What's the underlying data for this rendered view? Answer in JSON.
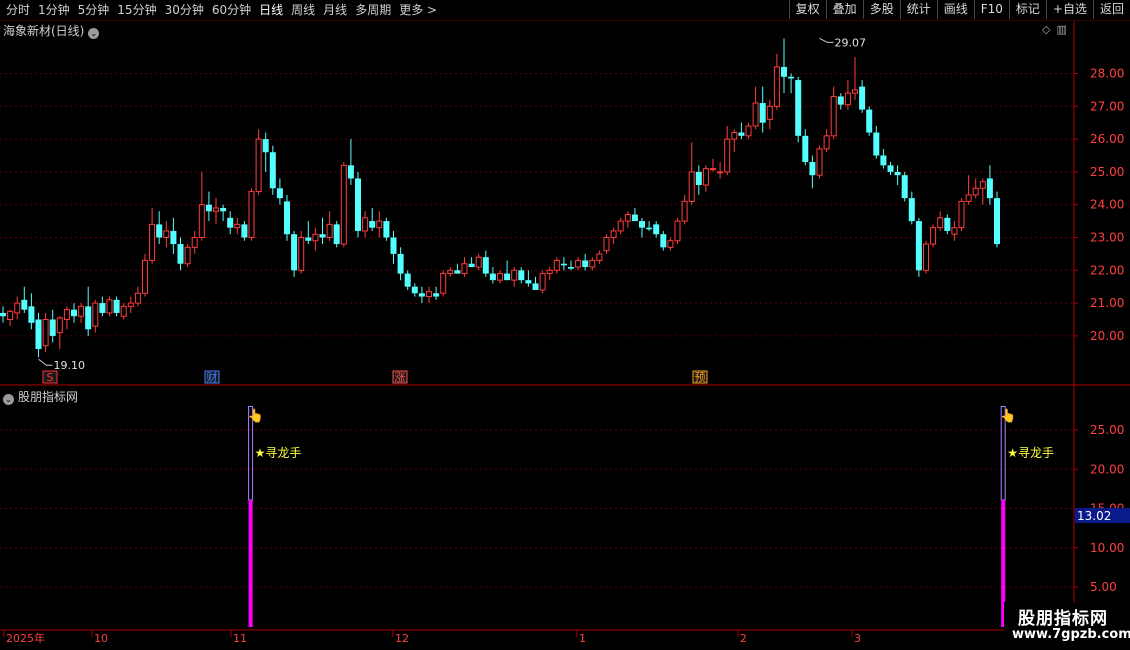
{
  "toolbar": {
    "periods": [
      "分时",
      "1分钟",
      "5分钟",
      "15分钟",
      "30分钟",
      "60分钟",
      "日线",
      "周线",
      "月线",
      "多周期",
      "更多 >"
    ],
    "active_period": "日线",
    "tools": [
      "复权",
      "叠加",
      "多股",
      "统计",
      "画线",
      "F10",
      "标记",
      "+自选",
      "返回"
    ]
  },
  "chart": {
    "title": "海象新材(日线)",
    "high_label": "29.07",
    "low_label": "19.10",
    "y_ticks": [
      "28.00",
      "27.00",
      "26.00",
      "25.00",
      "24.00",
      "23.00",
      "22.00",
      "21.00",
      "20.00"
    ],
    "markers": [
      {
        "label": "S",
        "color": "#ff3030"
      },
      {
        "label": "财",
        "color": "#4080ff"
      },
      {
        "label": "涨",
        "color": "#ff5050"
      },
      {
        "label": "预",
        "color": "#ffa020"
      }
    ]
  },
  "indicator": {
    "title": "股朋指标网",
    "y_ticks": [
      "25.00",
      "20.00",
      "15.00",
      "10.00",
      "5.00"
    ],
    "current_value": "13.02",
    "signal_label": "★寻龙手"
  },
  "time_axis": [
    "2025年",
    "10",
    "11",
    "12",
    "1",
    "2",
    "3"
  ],
  "watermark": {
    "line1": "股朋指标网",
    "line2": "www.7gpzb.com"
  },
  "colors": {
    "up": "#ff3c3c",
    "down": "#54ffff",
    "signal": "#ff00ff",
    "grid": "#5a0000",
    "axis": "#b00000"
  },
  "chart_data": {
    "type": "candlestick",
    "title": "海象新材(日线)",
    "ylim": [
      19.2,
      29.6
    ],
    "candles": [
      [
        20.7,
        20.9,
        20.4,
        20.6
      ],
      [
        20.5,
        20.8,
        20.3,
        20.75
      ],
      [
        20.7,
        21.2,
        20.5,
        21.0
      ],
      [
        21.1,
        21.5,
        20.7,
        20.8
      ],
      [
        20.9,
        21.3,
        20.2,
        20.4
      ],
      [
        20.5,
        20.7,
        19.35,
        19.6
      ],
      [
        19.7,
        20.7,
        19.5,
        20.5
      ],
      [
        20.5,
        20.8,
        19.8,
        20.0
      ],
      [
        20.1,
        20.6,
        19.6,
        20.55
      ],
      [
        20.5,
        20.9,
        20.2,
        20.8
      ],
      [
        20.8,
        21.0,
        20.4,
        20.6
      ],
      [
        20.6,
        21.0,
        20.4,
        20.9
      ],
      [
        20.9,
        21.5,
        20.0,
        20.2
      ],
      [
        20.3,
        21.1,
        20.1,
        21.0
      ],
      [
        21.0,
        21.2,
        20.6,
        20.7
      ],
      [
        20.7,
        21.2,
        20.6,
        21.1
      ],
      [
        21.1,
        21.2,
        20.6,
        20.7
      ],
      [
        20.6,
        21.0,
        20.5,
        20.9
      ],
      [
        20.9,
        21.2,
        20.7,
        21.0
      ],
      [
        21.0,
        21.5,
        20.9,
        21.3
      ],
      [
        21.3,
        22.5,
        21.2,
        22.3
      ],
      [
        22.3,
        23.9,
        22.2,
        23.4
      ],
      [
        23.4,
        23.8,
        22.8,
        23.0
      ],
      [
        23.0,
        23.5,
        22.7,
        23.2
      ],
      [
        23.2,
        23.6,
        22.5,
        22.8
      ],
      [
        22.8,
        23.0,
        22.0,
        22.2
      ],
      [
        22.2,
        22.8,
        22.1,
        22.7
      ],
      [
        22.7,
        23.2,
        22.5,
        23.0
      ],
      [
        23.0,
        25.0,
        22.9,
        24.0
      ],
      [
        24.0,
        24.4,
        23.5,
        23.8
      ],
      [
        23.8,
        24.2,
        23.4,
        23.9
      ],
      [
        23.9,
        24.0,
        23.5,
        23.8
      ],
      [
        23.6,
        23.8,
        23.1,
        23.3
      ],
      [
        23.3,
        23.6,
        23.1,
        23.4
      ],
      [
        23.4,
        23.5,
        22.9,
        23.0
      ],
      [
        23.0,
        24.5,
        22.9,
        24.4
      ],
      [
        24.4,
        26.3,
        24.3,
        26.0
      ],
      [
        26.0,
        26.2,
        25.0,
        25.6
      ],
      [
        25.6,
        25.8,
        24.3,
        24.5
      ],
      [
        24.5,
        24.8,
        24.0,
        24.2
      ],
      [
        24.1,
        24.3,
        22.9,
        23.1
      ],
      [
        23.1,
        23.2,
        21.8,
        22.0
      ],
      [
        22.0,
        23.2,
        21.9,
        23.0
      ],
      [
        23.0,
        23.5,
        22.8,
        22.9
      ],
      [
        22.9,
        23.3,
        22.6,
        23.1
      ],
      [
        23.1,
        23.6,
        22.8,
        23.0
      ],
      [
        23.0,
        23.8,
        22.9,
        23.4
      ],
      [
        23.4,
        23.5,
        22.7,
        22.8
      ],
      [
        22.8,
        25.3,
        22.7,
        25.2
      ],
      [
        25.2,
        26.0,
        24.6,
        24.8
      ],
      [
        24.8,
        25.0,
        23.0,
        23.2
      ],
      [
        23.2,
        23.8,
        23.0,
        23.6
      ],
      [
        23.5,
        23.9,
        23.2,
        23.3
      ],
      [
        23.3,
        23.8,
        23.0,
        23.5
      ],
      [
        23.5,
        23.6,
        22.9,
        23.0
      ],
      [
        23.0,
        23.2,
        22.2,
        22.5
      ],
      [
        22.5,
        22.7,
        21.7,
        21.9
      ],
      [
        21.9,
        22.0,
        21.4,
        21.5
      ],
      [
        21.5,
        21.6,
        21.2,
        21.3
      ],
      [
        21.3,
        21.5,
        21.0,
        21.2
      ],
      [
        21.2,
        21.5,
        21.0,
        21.35
      ],
      [
        21.3,
        21.5,
        21.1,
        21.2
      ],
      [
        21.3,
        22.0,
        21.2,
        21.9
      ],
      [
        21.9,
        22.1,
        21.8,
        22.0
      ],
      [
        22.0,
        22.2,
        21.9,
        21.9
      ],
      [
        21.9,
        22.4,
        21.8,
        22.2
      ],
      [
        22.2,
        22.4,
        22.1,
        22.1
      ],
      [
        22.1,
        22.5,
        22.0,
        22.4
      ],
      [
        22.4,
        22.6,
        21.8,
        21.9
      ],
      [
        21.9,
        22.1,
        21.6,
        21.7
      ],
      [
        21.7,
        22.0,
        21.6,
        21.9
      ],
      [
        21.9,
        22.3,
        21.7,
        21.7
      ],
      [
        21.7,
        22.1,
        21.5,
        22.0
      ],
      [
        22.0,
        22.1,
        21.6,
        21.7
      ],
      [
        21.7,
        22.0,
        21.5,
        21.6
      ],
      [
        21.6,
        21.8,
        21.4,
        21.4
      ],
      [
        21.4,
        22.0,
        21.3,
        21.9
      ],
      [
        21.9,
        22.1,
        21.7,
        22.0
      ],
      [
        22.0,
        22.4,
        21.9,
        22.3
      ],
      [
        22.2,
        22.4,
        22.0,
        22.15
      ],
      [
        22.1,
        22.3,
        22.0,
        22.05
      ],
      [
        22.1,
        22.4,
        22.0,
        22.3
      ],
      [
        22.3,
        22.5,
        22.0,
        22.1
      ],
      [
        22.1,
        22.4,
        22.0,
        22.3
      ],
      [
        22.3,
        22.6,
        22.2,
        22.5
      ],
      [
        22.6,
        23.1,
        22.5,
        23.0
      ],
      [
        23.0,
        23.3,
        22.8,
        23.2
      ],
      [
        23.2,
        23.6,
        23.1,
        23.5
      ],
      [
        23.5,
        23.8,
        23.3,
        23.7
      ],
      [
        23.7,
        23.9,
        23.5,
        23.5
      ],
      [
        23.5,
        23.6,
        23.0,
        23.3
      ],
      [
        23.3,
        23.5,
        23.2,
        23.25
      ],
      [
        23.4,
        23.5,
        23.0,
        23.1
      ],
      [
        23.1,
        23.2,
        22.6,
        22.7
      ],
      [
        22.7,
        23.0,
        22.6,
        22.9
      ],
      [
        22.9,
        23.6,
        22.8,
        23.5
      ],
      [
        23.5,
        24.3,
        23.4,
        24.1
      ],
      [
        24.1,
        25.9,
        24.0,
        25.0
      ],
      [
        25.0,
        25.2,
        24.3,
        24.6
      ],
      [
        24.6,
        25.2,
        24.4,
        25.1
      ],
      [
        25.1,
        25.4,
        25.0,
        25.1
      ],
      [
        25.0,
        25.3,
        24.8,
        25.0
      ],
      [
        25.0,
        26.4,
        24.9,
        26.0
      ],
      [
        26.0,
        26.3,
        25.6,
        26.2
      ],
      [
        26.2,
        26.5,
        26.0,
        26.1
      ],
      [
        26.1,
        26.5,
        26.0,
        26.4
      ],
      [
        26.4,
        27.6,
        26.3,
        27.1
      ],
      [
        27.1,
        27.6,
        26.2,
        26.5
      ],
      [
        26.6,
        27.2,
        26.3,
        27.0
      ],
      [
        27.0,
        28.6,
        26.9,
        28.2
      ],
      [
        28.2,
        29.07,
        27.4,
        27.9
      ],
      [
        27.9,
        28.0,
        27.4,
        27.85
      ],
      [
        27.8,
        27.9,
        25.9,
        26.1
      ],
      [
        26.1,
        26.3,
        25.2,
        25.3
      ],
      [
        25.3,
        25.5,
        24.5,
        24.9
      ],
      [
        24.9,
        25.8,
        24.8,
        25.7
      ],
      [
        25.7,
        26.3,
        25.6,
        26.1
      ],
      [
        26.1,
        27.6,
        26.0,
        27.3
      ],
      [
        27.3,
        27.4,
        26.9,
        27.05
      ],
      [
        27.05,
        27.8,
        26.9,
        27.4
      ],
      [
        27.4,
        28.5,
        27.2,
        27.5
      ],
      [
        27.6,
        27.8,
        26.8,
        26.9
      ],
      [
        26.9,
        27.0,
        26.1,
        26.2
      ],
      [
        26.2,
        26.4,
        25.4,
        25.5
      ],
      [
        25.5,
        25.7,
        25.1,
        25.2
      ],
      [
        25.2,
        25.3,
        24.9,
        25.0
      ],
      [
        25.0,
        25.2,
        24.6,
        24.9
      ],
      [
        24.9,
        25.0,
        24.1,
        24.2
      ],
      [
        24.2,
        24.4,
        23.4,
        23.5
      ],
      [
        23.5,
        23.6,
        21.8,
        22.0
      ],
      [
        22.0,
        22.9,
        21.9,
        22.8
      ],
      [
        22.8,
        23.4,
        22.7,
        23.3
      ],
      [
        23.3,
        23.8,
        23.2,
        23.6
      ],
      [
        23.6,
        23.7,
        23.1,
        23.2
      ],
      [
        23.1,
        23.5,
        22.9,
        23.3
      ],
      [
        23.3,
        24.2,
        23.2,
        24.1
      ],
      [
        24.1,
        24.9,
        24.0,
        24.3
      ],
      [
        24.3,
        24.8,
        24.2,
        24.5
      ],
      [
        24.5,
        24.8,
        24.0,
        24.7
      ],
      [
        24.8,
        25.2,
        24.0,
        24.2
      ],
      [
        24.2,
        24.4,
        22.7,
        22.8
      ]
    ],
    "indicator_signals": [
      {
        "index": 36,
        "value": 28.0
      },
      {
        "index": 142,
        "value": 28.0
      }
    ]
  }
}
